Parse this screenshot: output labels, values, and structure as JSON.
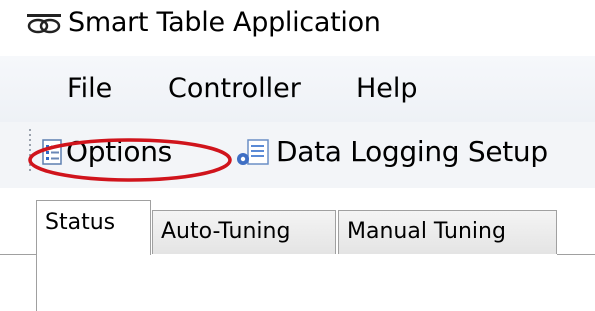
{
  "window": {
    "title": "Smart Table Application",
    "icon": "app-logo-icon"
  },
  "menu": {
    "items": [
      {
        "label": "File"
      },
      {
        "label": "Controller"
      },
      {
        "label": "Help"
      }
    ]
  },
  "toolbar": {
    "options_label": "Options",
    "options_icon": "options-list-icon",
    "data_logging_label": "Data Logging Setup",
    "data_logging_icon": "data-logging-icon",
    "highlight_color": "#d0141c"
  },
  "tabs": {
    "items": [
      {
        "label": "Status",
        "active": true
      },
      {
        "label": "Auto-Tuning",
        "active": false
      },
      {
        "label": "Manual Tuning",
        "active": false
      }
    ]
  }
}
